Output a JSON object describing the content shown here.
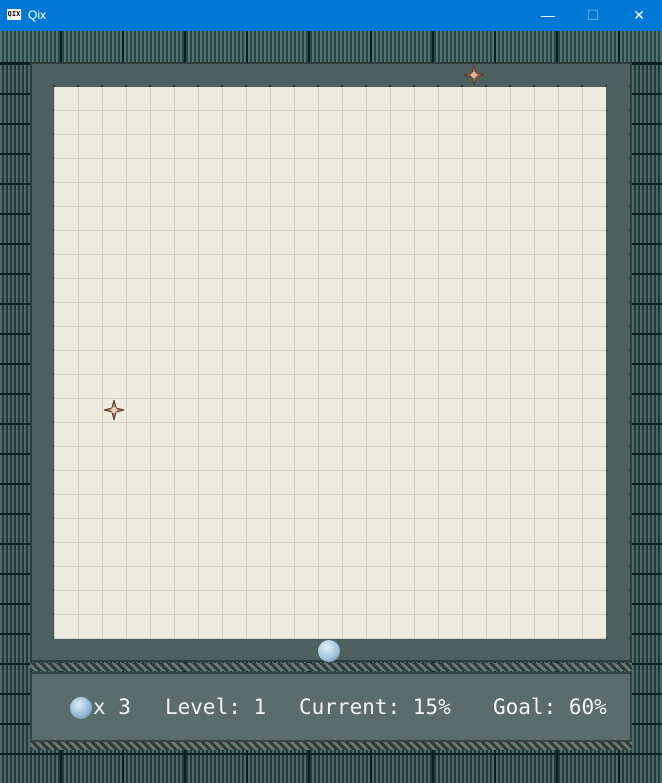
{
  "window": {
    "title": "Qix",
    "icon_text": "QIX",
    "controls": {
      "minimize": "—",
      "maximize": "☐",
      "close": "✕"
    }
  },
  "hud": {
    "lives_label": "x 3",
    "level_label": "Level: 1",
    "current_label": "Current: 15%",
    "goal_label": "Goal: 60%"
  },
  "game": {
    "lives": 3,
    "level": 1,
    "current_percent": 15,
    "goal_percent": 60,
    "colors": {
      "field": "#eeebdf",
      "border": "#4e605f",
      "player": "#9dc1d8",
      "enemy": "#b07a5a"
    }
  }
}
